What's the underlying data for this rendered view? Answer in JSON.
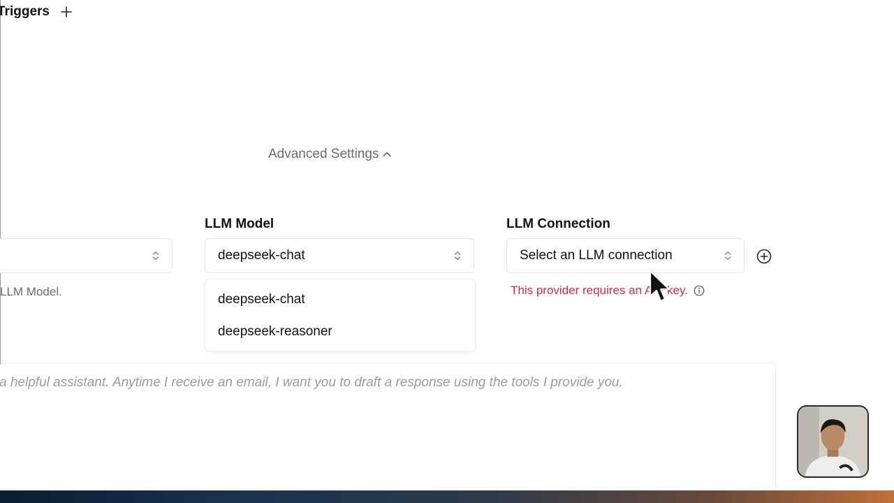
{
  "triggers": {
    "title": "Triggers"
  },
  "advanced_settings": {
    "label": "Advanced Settings"
  },
  "form": {
    "left_select": {
      "value": "",
      "help_text": "LLM Model."
    },
    "llm_model": {
      "label": "LLM Model",
      "value": "deepseek-chat",
      "options": [
        "deepseek-chat",
        "deepseek-reasoner"
      ]
    },
    "llm_connection": {
      "label": "LLM Connection",
      "placeholder": "Select an LLM connection",
      "error_text": "This provider requires an API key."
    }
  },
  "prompt": {
    "text": "a helpful assistant. Anytime I receive an email, I want you to draft a response using the tools I provide you."
  },
  "icons": {
    "add_trigger": "plus-icon",
    "advanced_toggle": "chevron-up-icon",
    "select_indicator": "chevron-up-down-icon",
    "add_connection": "plus-circle-icon",
    "error_info": "info-icon",
    "cursor": "mouse-pointer-icon"
  },
  "colors": {
    "error": "#c8314a",
    "muted_text": "#6b6b6b",
    "placeholder": "#9b9b9b",
    "border": "#e6e6e6"
  }
}
